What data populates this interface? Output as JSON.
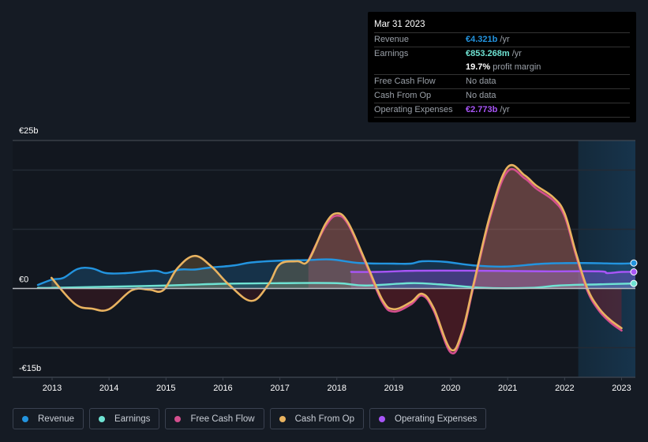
{
  "tooltip": {
    "date": "Mar 31 2023",
    "rows": [
      {
        "label": "Revenue",
        "value": "€4.321b",
        "suffix": " /yr",
        "color": "#2394df"
      },
      {
        "label": "Earnings",
        "value": "€853.268m",
        "suffix": " /yr",
        "color": "#6fe3d3"
      },
      {
        "label": "",
        "value": "19.7%",
        "suffix": " profit margin",
        "color": "#ffffff"
      },
      {
        "label": "Free Cash Flow",
        "value": "",
        "suffix": "No data",
        "color": "#9aa0a8"
      },
      {
        "label": "Cash From Op",
        "value": "",
        "suffix": "No data",
        "color": "#9aa0a8"
      },
      {
        "label": "Operating Expenses",
        "value": "€2.773b",
        "suffix": " /yr",
        "color": "#a855f7"
      }
    ]
  },
  "legend": [
    {
      "label": "Revenue",
      "color": "#2394df"
    },
    {
      "label": "Earnings",
      "color": "#6fe3d3"
    },
    {
      "label": "Free Cash Flow",
      "color": "#d44f8e"
    },
    {
      "label": "Cash From Op",
      "color": "#e9b360"
    },
    {
      "label": "Operating Expenses",
      "color": "#a855f7"
    }
  ],
  "chart_data": {
    "type": "area",
    "title": "",
    "xlabel": "",
    "ylabel": "",
    "y_unit": "€ billions",
    "ylim": [
      -15,
      25
    ],
    "xlim": [
      2012.3,
      2023.25
    ],
    "y_tick_labels": [
      {
        "value": 25,
        "label": "€25b"
      },
      {
        "value": 0,
        "label": "€0"
      },
      {
        "value": -15,
        "label": "-€15b"
      }
    ],
    "gridlines": [
      20,
      10,
      -10
    ],
    "x_ticks": [
      2013,
      2014,
      2015,
      2016,
      2017,
      2018,
      2019,
      2020,
      2021,
      2022,
      2023
    ],
    "highlight_range": [
      2022.24,
      2023.25
    ],
    "series": [
      {
        "name": "Revenue",
        "color": "#2394df",
        "x": [
          2012.75,
          2013.0,
          2013.2,
          2013.45,
          2013.7,
          2013.95,
          2014.3,
          2014.8,
          2015.0,
          2015.25,
          2015.5,
          2015.75,
          2016.2,
          2016.5,
          2017.0,
          2017.5,
          2017.9,
          2018.4,
          2019.0,
          2019.3,
          2019.5,
          2019.9,
          2020.4,
          2020.95,
          2021.65,
          2022.35,
          2023.0,
          2023.25
        ],
        "y": [
          0.6,
          1.5,
          1.8,
          3.3,
          3.4,
          2.6,
          2.6,
          3.0,
          2.6,
          3.2,
          3.2,
          3.5,
          3.9,
          4.4,
          4.7,
          4.8,
          4.9,
          4.3,
          4.2,
          4.2,
          4.6,
          4.5,
          3.9,
          3.7,
          4.2,
          4.3,
          4.2,
          4.3
        ]
      },
      {
        "name": "Earnings",
        "color": "#6fe3d3",
        "x": [
          2012.75,
          2013.0,
          2014.0,
          2015.0,
          2016.0,
          2017.0,
          2018.0,
          2018.5,
          2019.3,
          2019.8,
          2020.6,
          2021.4,
          2021.9,
          2022.6,
          2023.25
        ],
        "y": [
          0.1,
          0.1,
          0.3,
          0.5,
          0.8,
          0.9,
          0.9,
          0.5,
          0.9,
          0.7,
          0.1,
          0.1,
          0.5,
          0.7,
          0.85
        ]
      },
      {
        "name": "Free Cash Flow",
        "color": "#d44f8e",
        "x": [
          2017.5,
          2017.8,
          2018.0,
          2018.2,
          2018.5,
          2018.8,
          2019.0,
          2019.3,
          2019.5,
          2019.7,
          2020.0,
          2020.2,
          2020.4,
          2020.7,
          2021.0,
          2021.3,
          2021.5,
          2021.8,
          2022.0,
          2022.2,
          2022.4,
          2022.6,
          2022.8,
          2023.0
        ],
        "y": [
          4.7,
          10.5,
          12.3,
          10.8,
          4.4,
          -2.3,
          -3.9,
          -2.7,
          -1.2,
          -3.7,
          -10.8,
          -7.8,
          0.3,
          12.2,
          19.8,
          18.6,
          16.9,
          14.9,
          12.2,
          5.6,
          -0.4,
          -3.7,
          -5.7,
          -7.1
        ]
      },
      {
        "name": "Cash From Op",
        "color": "#e9b360",
        "x": [
          2012.99,
          2013.4,
          2013.7,
          2014.0,
          2014.4,
          2014.7,
          2014.95,
          2015.2,
          2015.5,
          2015.8,
          2016.1,
          2016.5,
          2016.8,
          2017.0,
          2017.3,
          2017.5,
          2017.8,
          2018.0,
          2018.2,
          2018.5,
          2018.8,
          2019.0,
          2019.3,
          2019.5,
          2019.7,
          2020.0,
          2020.2,
          2020.4,
          2020.7,
          2021.0,
          2021.3,
          2021.5,
          2021.8,
          2022.0,
          2022.2,
          2022.4,
          2022.6,
          2022.8,
          2023.0
        ],
        "y": [
          1.8,
          -2.6,
          -3.4,
          -3.5,
          -0.3,
          -0.2,
          -0.3,
          3.4,
          5.5,
          3.7,
          0.7,
          -2.1,
          0.7,
          4.1,
          4.6,
          4.7,
          10.9,
          12.7,
          11.1,
          4.7,
          -1.9,
          -3.5,
          -2.3,
          -0.9,
          -3.3,
          -10.3,
          -7.3,
          0.7,
          12.7,
          20.5,
          19.1,
          17.4,
          15.4,
          12.7,
          6.0,
          0.0,
          -3.3,
          -5.3,
          -6.7
        ]
      },
      {
        "name": "Operating Expenses",
        "color": "#a855f7",
        "x": [
          2018.25,
          2018.7,
          2019.4,
          2020.4,
          2021.6,
          2022.6,
          2022.75,
          2023.0,
          2023.25
        ],
        "y": [
          2.8,
          2.8,
          3.0,
          3.0,
          2.9,
          2.9,
          2.6,
          2.8,
          2.8
        ]
      }
    ]
  }
}
